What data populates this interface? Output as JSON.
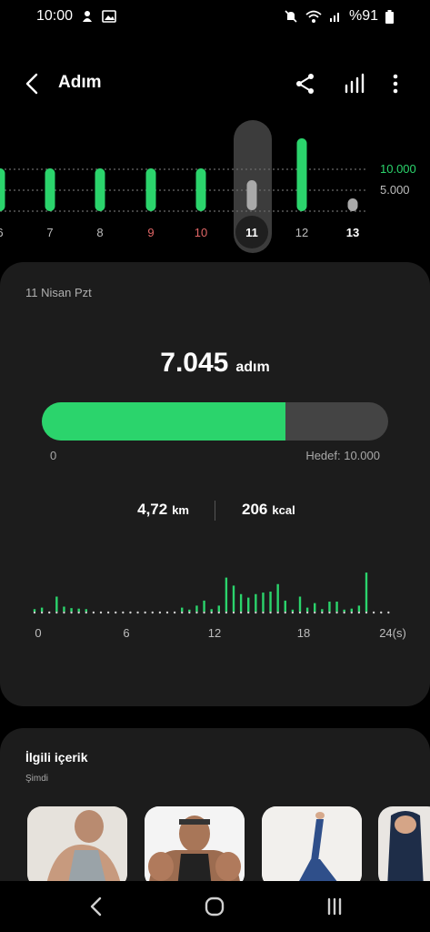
{
  "status": {
    "time": "10:00",
    "battery": "%91"
  },
  "header": {
    "title": "Adım"
  },
  "days": {
    "labels": [
      "6",
      "7",
      "8",
      "9",
      "10",
      "11",
      "12",
      "13"
    ],
    "label_colors": [
      "#bdbdbd",
      "#bdbdbd",
      "#bdbdbd",
      "#e06666",
      "#e06666",
      "#ffffff",
      "#bdbdbd",
      "#ffffff"
    ],
    "values": [
      7500,
      6800,
      5700,
      6000,
      6100,
      7045,
      9000,
      300
    ],
    "ref_high": "10.000",
    "ref_low": "5.000",
    "selected": "11"
  },
  "summary": {
    "date": "11 Nisan Pzt",
    "steps": "7.045",
    "steps_unit": "adım",
    "progress": 0.7045,
    "min_label": "0",
    "goal_label": "Hedef: 10.000",
    "distance": "4,72",
    "distance_unit": "km",
    "calories": "206",
    "calories_unit": "kcal"
  },
  "hourly": {
    "tick_labels": [
      "0",
      "6",
      "12",
      "18",
      "24(s)"
    ],
    "values": [
      5,
      8,
      3,
      30,
      10,
      7,
      6,
      5,
      3,
      3,
      3,
      3,
      3,
      3,
      3,
      3,
      3,
      3,
      3,
      3,
      8,
      4,
      12,
      22,
      5,
      12,
      68,
      52,
      35,
      28,
      35,
      38,
      40,
      55,
      22,
      4,
      30,
      8,
      17,
      5,
      20,
      20,
      4,
      6,
      12,
      78
    ]
  },
  "related": {
    "title": "İlgili içerik",
    "subtitle": "Şimdi"
  },
  "colors": {
    "accent": "#2bd46c",
    "card": "#1c1c1c",
    "weekend": "#e06666"
  }
}
